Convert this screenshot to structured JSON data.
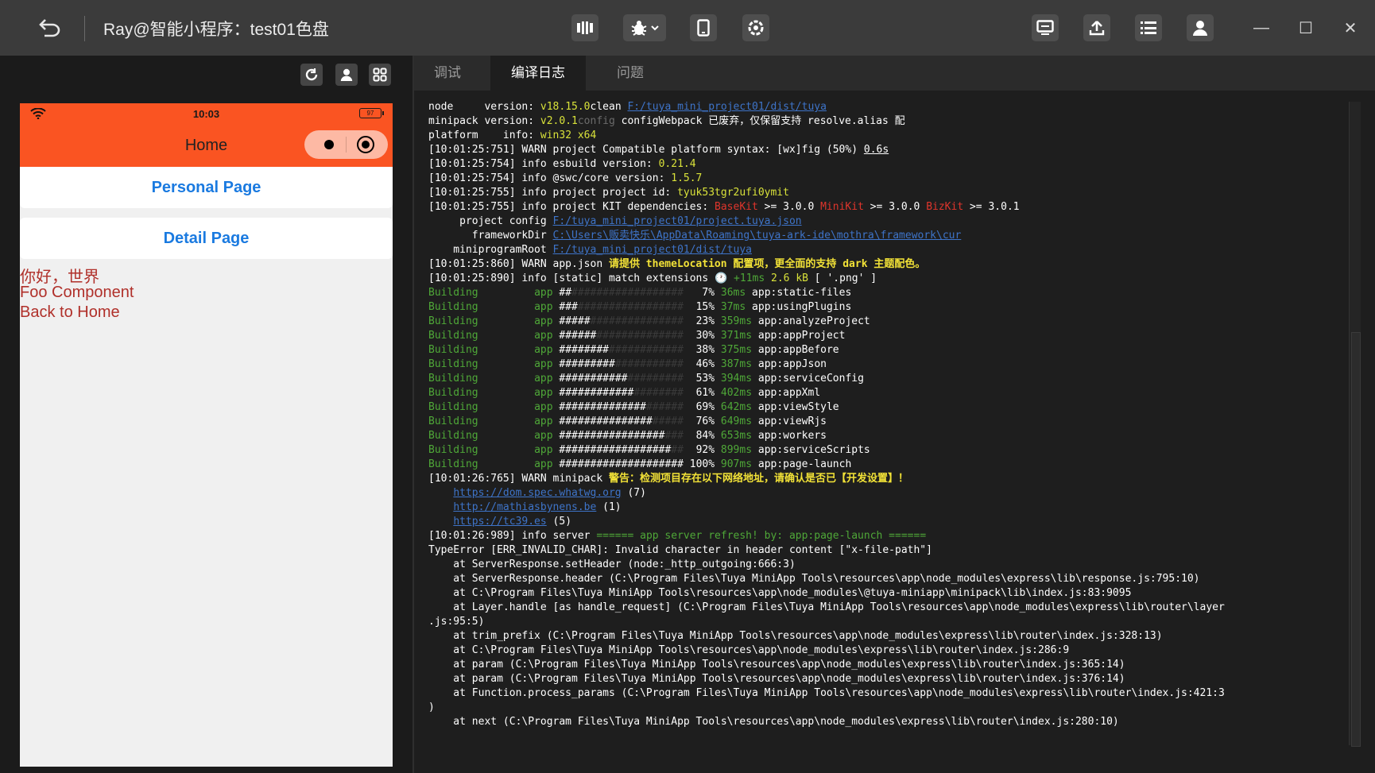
{
  "window": {
    "title": "Ray@智能小程序：test01色盘",
    "colors": {
      "titlebar": "#3b3b3b",
      "accent": "#fa5422",
      "link": "#1a7ae0",
      "error_text": "#b0302a"
    }
  },
  "toolbar": {
    "icons": [
      "back-icon",
      "compile-mode-icon",
      "debug-icon",
      "dropdown-icon",
      "preview-device-icon",
      "plugin-icon",
      "remote-debug-icon",
      "upload-icon",
      "details-icon",
      "user-icon"
    ],
    "window_controls": {
      "minimize": "—",
      "maximize": "☐",
      "close": "✕"
    }
  },
  "simulator": {
    "tool_icons": [
      "refresh-icon",
      "user-icon",
      "grid-icon"
    ],
    "status": {
      "time": "10:03",
      "battery": "97"
    },
    "nav_title": "Home",
    "cards": [
      "Personal Page",
      "Detail Page"
    ],
    "texts": [
      "你好，世界",
      "Foo Component",
      "Back to Home"
    ]
  },
  "tabs": [
    {
      "label": "调试",
      "active": false
    },
    {
      "label": "编译日志",
      "active": true
    },
    {
      "label": "问题",
      "active": false
    }
  ],
  "log": {
    "header": [
      [
        "node     version: ",
        "v18.15.0",
        "clean ",
        "F:/tuya_mini_project01/dist/tuya"
      ],
      [
        "minipack version: ",
        "v2.0.1",
        "config",
        " configWebpack 已废弃，仅保留支持 resolve.alias 配"
      ],
      [
        "platform    info: ",
        "win32 x64"
      ]
    ],
    "info_lines": [
      "[10:01:25:751] WARN project Compatible platform syntax: [wx]fig (50%) ",
      "0.6s",
      "[10:01:25:754] info esbuild version: ",
      "0.21.4",
      "[10:01:25:754] info @swc/core version: ",
      "1.5.7",
      "[10:01:25:755] info project project id: ",
      "tyuk53tgr2ufi0ymit",
      "[10:01:25:755] info project KIT dependencies: ",
      "BaseKit",
      " >= 3.0.0 ",
      "MiniKit",
      " >= 3.0.0 ",
      "BizKit",
      " >= 3.0.1"
    ],
    "paths": [
      [
        "     project config ",
        "F:/tuya_mini_project01/project.tuya.json"
      ],
      [
        "       frameworkDir ",
        "C:\\Users\\贩卖快乐\\AppData\\Roaming\\tuya-ark-ide\\mothra\\framework\\cur"
      ],
      [
        "    miniprogramRoot ",
        "F:/tuya_mini_project01/dist/tuya"
      ]
    ],
    "appjson": [
      "[10:01:25:860] WARN app.json ",
      "请提供 themeLocation 配置项，更全面的支持 dark 主题配色。"
    ],
    "static": [
      "[10:01:25:890] info [static] match extensions ",
      "🕐",
      " +11ms ",
      "2.6 kB",
      " [ '.png' ]"
    ],
    "building": [
      [
        "##",
        "7%",
        "36ms",
        "app:static-files"
      ],
      [
        "###",
        "15%",
        "37ms",
        "app:usingPlugins"
      ],
      [
        "#####",
        "23%",
        "359ms",
        "app:analyzeProject"
      ],
      [
        "######",
        "30%",
        "371ms",
        "app:appProject"
      ],
      [
        "########",
        "38%",
        "375ms",
        "app:appBefore"
      ],
      [
        "#########",
        "46%",
        "387ms",
        "app:appJson"
      ],
      [
        "###########",
        "53%",
        "394ms",
        "app:serviceConfig"
      ],
      [
        "############",
        "61%",
        "402ms",
        "app:appXml"
      ],
      [
        "##############",
        "69%",
        "642ms",
        "app:viewStyle"
      ],
      [
        "###############",
        "76%",
        "649ms",
        "app:viewRjs"
      ],
      [
        "#################",
        "84%",
        "653ms",
        "app:workers"
      ],
      [
        "##################",
        "92%",
        "899ms",
        "app:serviceScripts"
      ],
      [
        "####################",
        "100%",
        "907ms",
        "app:page-launch"
      ]
    ],
    "building_word": "Building",
    "building_app": "app",
    "minipack_warn": [
      "[10:01:26:765] WARN minipack ",
      "警告：检测项目存在以下网络地址，请确认是否已【开发设置】！"
    ],
    "urls": [
      [
        "https://dom.spec.whatwg.org",
        " (7)"
      ],
      [
        "http://mathiasbynens.be",
        " (1)"
      ],
      [
        "https://tc39.es",
        " (5)"
      ]
    ],
    "server": [
      "[10:01:26:989] info server ",
      "====== app server refresh! by: app:page-launch ======"
    ],
    "error_lines": [
      "TypeError [ERR_INVALID_CHAR]: Invalid character in header content [\"x-file-path\"]",
      "    at ServerResponse.setHeader (node:_http_outgoing:666:3)",
      "    at ServerResponse.header (C:\\Program Files\\Tuya MiniApp Tools\\resources\\app\\node_modules\\express\\lib\\response.js:795:10)",
      "    at C:\\Program Files\\Tuya MiniApp Tools\\resources\\app\\node_modules\\@tuya-miniapp\\minipack\\lib\\index.js:83:9095",
      "    at Layer.handle [as handle_request] (C:\\Program Files\\Tuya MiniApp Tools\\resources\\app\\node_modules\\express\\lib\\router\\layer",
      ".js:95:5)",
      "    at trim_prefix (C:\\Program Files\\Tuya MiniApp Tools\\resources\\app\\node_modules\\express\\lib\\router\\index.js:328:13)",
      "    at C:\\Program Files\\Tuya MiniApp Tools\\resources\\app\\node_modules\\express\\lib\\router\\index.js:286:9",
      "    at param (C:\\Program Files\\Tuya MiniApp Tools\\resources\\app\\node_modules\\express\\lib\\router\\index.js:365:14)",
      "    at param (C:\\Program Files\\Tuya MiniApp Tools\\resources\\app\\node_modules\\express\\lib\\router\\index.js:376:14)",
      "    at Function.process_params (C:\\Program Files\\Tuya MiniApp Tools\\resources\\app\\node_modules\\express\\lib\\router\\index.js:421:3",
      ")",
      "    at next (C:\\Program Files\\Tuya MiniApp Tools\\resources\\app\\node_modules\\express\\lib\\router\\index.js:280:10)"
    ]
  }
}
